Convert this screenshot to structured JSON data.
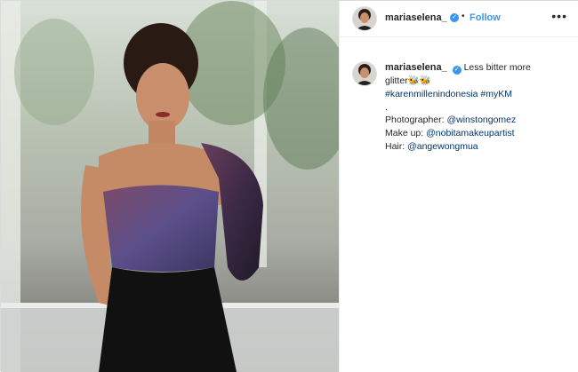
{
  "post": {
    "username": "mariaselena_",
    "follow_label": "Follow",
    "separator": "•",
    "more_label": "•••",
    "verified_mark": "✓",
    "caption": {
      "text_line1": "Less bitter more",
      "text_line2": "glitter🐝🐝",
      "hashtags": "#karenmillenindonesia #myKM",
      "dot_line": ".",
      "photographer_label": "Photographer:",
      "photographer_handle": "@winstongomez",
      "makeup_label": "Make up:",
      "makeup_handle": "@nobitamakeupartist",
      "hair_label": "Hair:",
      "hair_handle": "@angewongmua"
    }
  },
  "colors": {
    "link": "#003569",
    "follow": "#3897f0",
    "verified": "#3897f0",
    "text": "#262626",
    "border": "#dbdbdb"
  },
  "icons": {
    "more": "more-options-icon",
    "verified": "verified-badge-icon"
  }
}
